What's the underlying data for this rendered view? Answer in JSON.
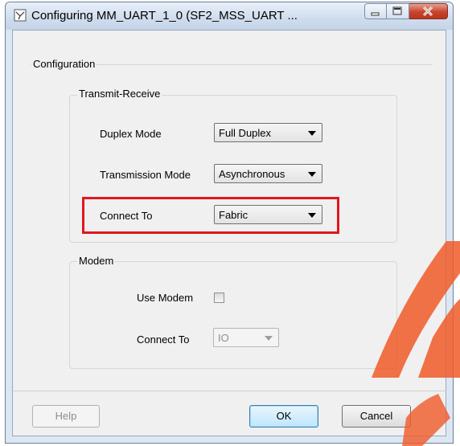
{
  "window": {
    "title": "Configuring MM_UART_1_0 (SF2_MSS_UART ...",
    "icons": [
      "config-icon",
      "minimize-icon",
      "maximize-icon",
      "close-icon"
    ]
  },
  "configuration": {
    "title": "Configuration",
    "transmit_receive": {
      "title": "Transmit-Receive",
      "duplex_mode_label": "Duplex Mode",
      "duplex_mode_value": "Full Duplex",
      "transmission_mode_label": "Transmission Mode",
      "transmission_mode_value": "Asynchronous",
      "connect_to_label": "Connect To",
      "connect_to_value": "Fabric"
    },
    "modem": {
      "title": "Modem",
      "use_modem_label": "Use Modem",
      "use_modem_checked": false,
      "connect_to_label": "Connect To",
      "connect_to_value": "IO"
    }
  },
  "buttons": {
    "help": "Help",
    "ok": "OK",
    "cancel": "Cancel"
  },
  "colors": {
    "highlight": "#e2161e",
    "watermark": "#f05a28"
  }
}
